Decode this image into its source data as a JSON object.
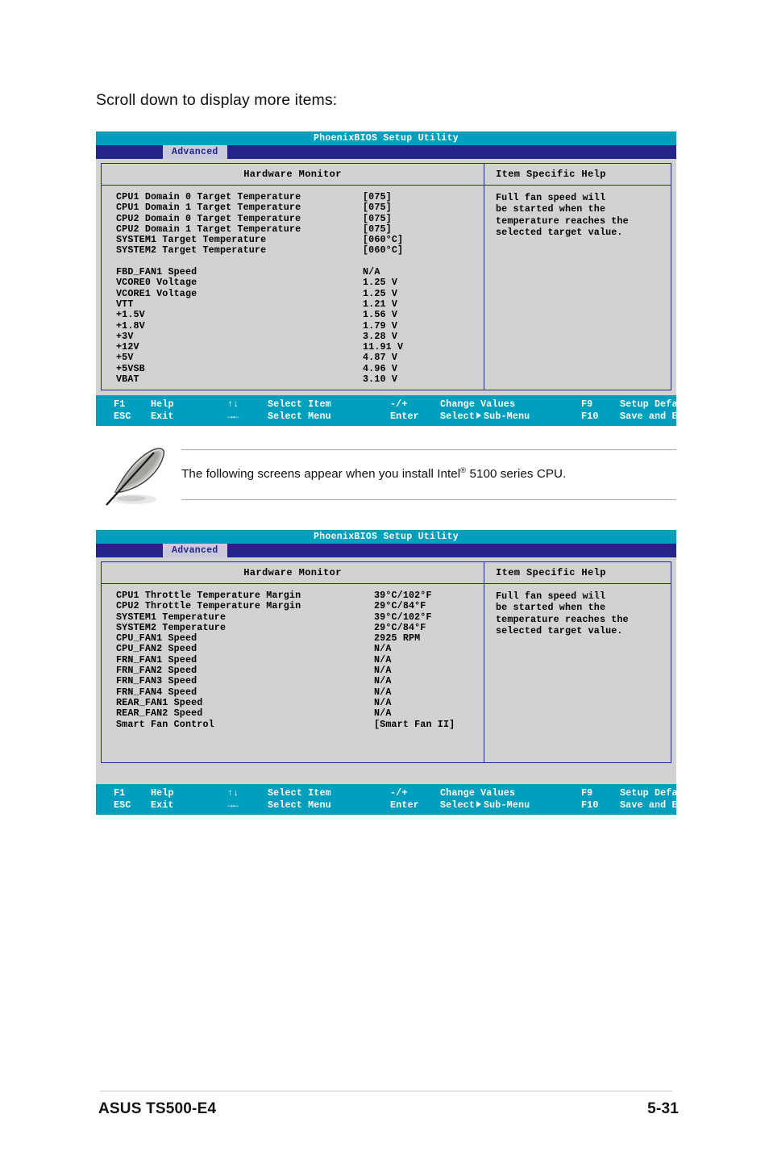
{
  "document": {
    "intro_heading": "Scroll down to display more items:",
    "footer_left": "ASUS TS500-E4",
    "footer_right": "5-31"
  },
  "note": {
    "icon": "quill-pen-icon",
    "text_before": "The following screens appear when you install Intel",
    "superscript": "®",
    "text_after": " 5100 series CPU."
  },
  "colors": {
    "title_bar": "#009fbe",
    "menu_bar": "#23248c",
    "tab_active_bg": "#c9c9dc",
    "tab_active_text": "#23248c",
    "panel_bg": "#d2d2d2",
    "panel_border": "#23248c",
    "footer_bar": "#009fbe"
  },
  "bios_footer": {
    "line1": {
      "key1": "F1",
      "desc1": "Help",
      "arrows": "↑↓",
      "desc2": "Select Item",
      "key2": "-/+",
      "desc3": "Change Values",
      "key3": "F9",
      "desc4": "Setup Defaults"
    },
    "line2": {
      "key1": "ESC",
      "desc1": "Exit",
      "arrows": "→←",
      "desc2": "Select Menu",
      "key2": "Enter",
      "desc3_a": "Select",
      "desc3_b": "Sub-Menu",
      "key3": "F10",
      "desc4": "Save and Exit"
    }
  },
  "screen1": {
    "title": "PhoenixBIOS Setup Utility",
    "tab": "Advanced",
    "panel_title": "Hardware Monitor",
    "help_title": "Item Specific Help",
    "help_body": "Full fan speed will\nbe started when the\ntemperature reaches the\nselected target value.",
    "rows": [
      {
        "label": "CPU1 Domain 0 Target Temperature",
        "value": "[075]"
      },
      {
        "label": "CPU1 Domain 1 Target Temperature",
        "value": "[075]"
      },
      {
        "label": "CPU2 Domain 0 Target Temperature",
        "value": "[075]"
      },
      {
        "label": "CPU2 Domain 1 Target Temperature",
        "value": "[075]"
      },
      {
        "label": "SYSTEM1 Target Temperature",
        "value": "[060°C]"
      },
      {
        "label": "SYSTEM2 Target Temperature",
        "value": "[060°C]"
      },
      {
        "label": "",
        "value": ""
      },
      {
        "label": "FBD_FAN1 Speed",
        "value": "N/A"
      },
      {
        "label": "VCORE0 Voltage",
        "value": "1.25 V"
      },
      {
        "label": "VCORE1 Voltage",
        "value": "1.25 V"
      },
      {
        "label": "VTT",
        "value": "1.21 V"
      },
      {
        "label": "+1.5V",
        "value": "1.56 V"
      },
      {
        "label": "+1.8V",
        "value": "1.79 V"
      },
      {
        "label": "+3V",
        "value": "3.28 V"
      },
      {
        "label": "+12V",
        "value": "11.91 V"
      },
      {
        "label": "+5V",
        "value": "4.87 V"
      },
      {
        "label": "+5VSB",
        "value": "4.96 V"
      },
      {
        "label": "VBAT",
        "value": "3.10 V"
      }
    ]
  },
  "screen2": {
    "title": "PhoenixBIOS Setup Utility",
    "tab": "Advanced",
    "panel_title": "Hardware Monitor",
    "help_title": "Item Specific Help",
    "help_body": "Full fan speed will\nbe started when the\ntemperature reaches the\nselected target value.",
    "rows": [
      {
        "label": "CPU1 Throttle Temperature Margin",
        "value": "39°C/102°F"
      },
      {
        "label": "CPU2 Throttle Temperature Margin",
        "value": "29°C/84°F"
      },
      {
        "label": "SYSTEM1 Temperature",
        "value": "39°C/102°F"
      },
      {
        "label": "SYSTEM2 Temperature",
        "value": "29°C/84°F"
      },
      {
        "label": "CPU_FAN1 Speed",
        "value": "2925 RPM"
      },
      {
        "label": "CPU_FAN2 Speed",
        "value": "N/A"
      },
      {
        "label": "FRN_FAN1 Speed",
        "value": "N/A"
      },
      {
        "label": "FRN_FAN2 Speed",
        "value": "N/A"
      },
      {
        "label": "FRN_FAN3 Speed",
        "value": "N/A"
      },
      {
        "label": "FRN_FAN4 Speed",
        "value": "N/A"
      },
      {
        "label": "REAR_FAN1 Speed",
        "value": "N/A"
      },
      {
        "label": "REAR_FAN2 Speed",
        "value": "N/A"
      },
      {
        "label": "Smart Fan Control",
        "value": "[Smart Fan II]"
      }
    ]
  }
}
